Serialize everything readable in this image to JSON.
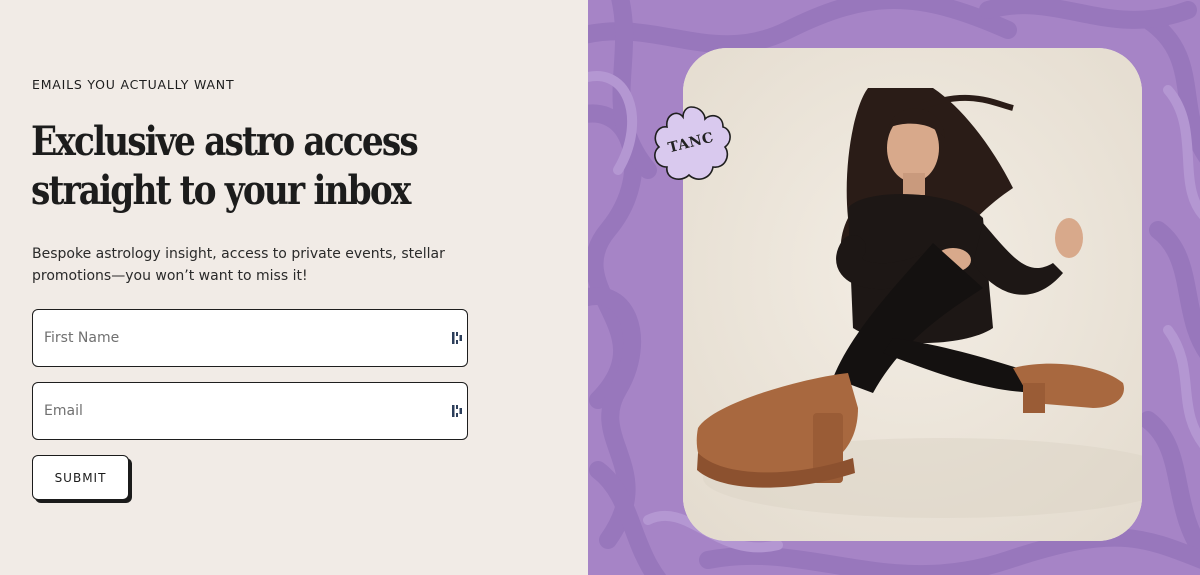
{
  "form_section": {
    "eyebrow": "EMAILS YOU ACTUALLY WANT",
    "headline_line1": "Exclusive astro access",
    "headline_line2": "straight to your inbox",
    "subcopy_line1": "Bespoke astrology insight, access to private events, stellar",
    "subcopy_line2": "promotions—you won’t want to miss it!",
    "first_name_placeholder": "First Name",
    "email_placeholder": "Email",
    "submit_label": "SUBMIT"
  },
  "image_section": {
    "badge_text": "TANC",
    "background_color": "#a684c6",
    "badge_color": "#d9c9ee",
    "icons": {
      "field_icon": "password-manager-icon"
    }
  }
}
